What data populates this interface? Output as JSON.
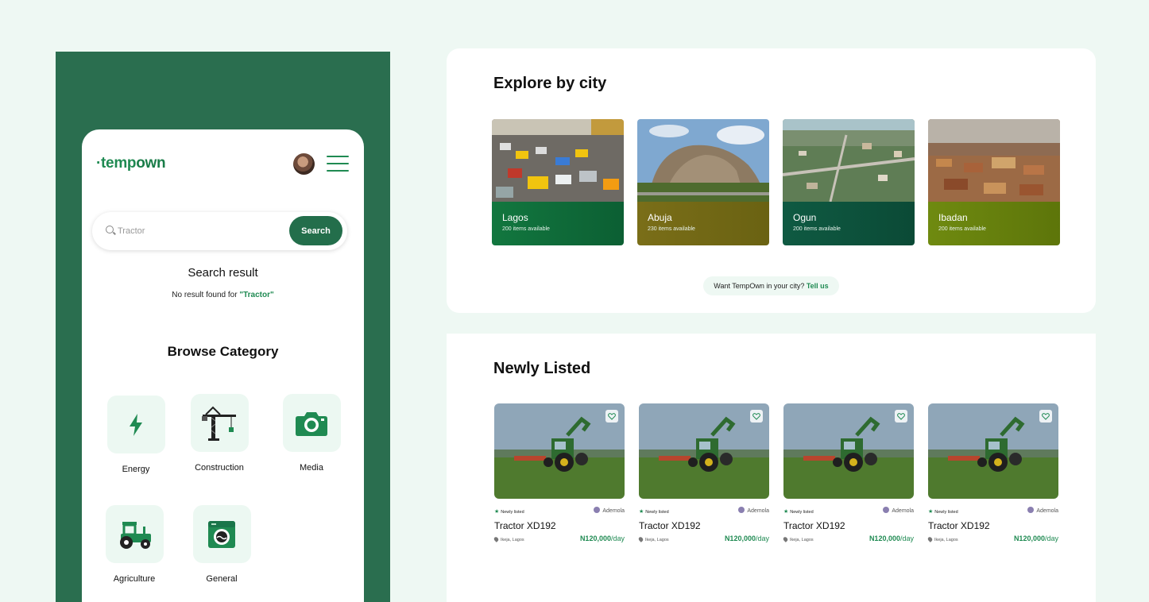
{
  "app": {
    "logo_dot": "·",
    "logo_temp": "temp",
    "logo_own": "own"
  },
  "search": {
    "placeholder": "Tractor",
    "button_label": "Search",
    "result_title": "Search result",
    "no_result_prefix": "No result found for ",
    "query_quoted": "\"Tractor\""
  },
  "browse": {
    "title": "Browse Category",
    "categories": [
      {
        "label": "Energy",
        "icon": "lightning-icon"
      },
      {
        "label": "Construction",
        "icon": "crane-icon"
      },
      {
        "label": "Media",
        "icon": "camera-icon"
      },
      {
        "label": "Agriculture",
        "icon": "tractor-icon"
      },
      {
        "label": "General",
        "icon": "washing-machine-icon"
      }
    ]
  },
  "explore": {
    "title": "Explore by city",
    "cities": [
      {
        "name": "Lagos",
        "count": "200 items available",
        "color": "#12773f"
      },
      {
        "name": "Abuja",
        "count": "230 items available",
        "color": "#7a6e18"
      },
      {
        "name": "Ogun",
        "count": "200 items available",
        "color": "#0f5a42"
      },
      {
        "name": "Ibadan",
        "count": "200 items available",
        "color": "#6f8a10"
      }
    ],
    "cta_text": "Want TempOwn in your city? ",
    "cta_link": "Tell us"
  },
  "newly_listed": {
    "title": "Newly Listed",
    "items": [
      {
        "badge": "Newly listed",
        "owner": "Ademola",
        "title": "Tractor XD192",
        "location": "Ikeja, Lagos",
        "price": "N120,000",
        "per": "/day"
      },
      {
        "badge": "Newly listed",
        "owner": "Ademola",
        "title": "Tractor XD192",
        "location": "Ikeja, Lagos",
        "price": "N120,000",
        "per": "/day"
      },
      {
        "badge": "Newly listed",
        "owner": "Ademola",
        "title": "Tractor XD192",
        "location": "Ikeja, Lagos",
        "price": "N120,000",
        "per": "/day"
      },
      {
        "badge": "Newly listed",
        "owner": "Ademola",
        "title": "Tractor XD192",
        "location": "Ikeja, Lagos",
        "price": "N120,000",
        "per": "/day"
      }
    ]
  },
  "colors": {
    "brand": "#1f8a52",
    "panel": "#2a6e4f",
    "page_bg": "#eef8f3"
  }
}
